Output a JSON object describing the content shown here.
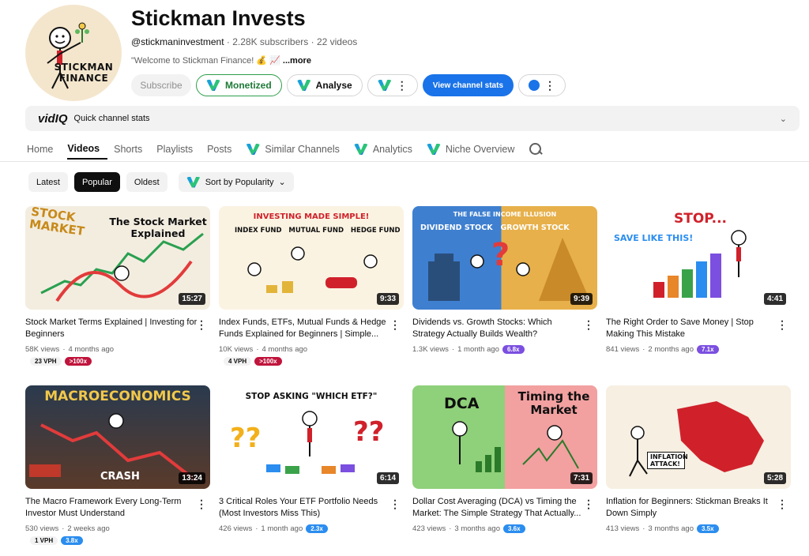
{
  "channel": {
    "avatar_text_1": "STICKMAN",
    "avatar_text_2": "FINANCE",
    "name": "Stickman Invests",
    "handle": "@stickmaninvestment",
    "stats": " · 2.28K subscribers · 22 videos",
    "description": "\"Welcome to Stickman Finance! 💰 📈",
    "more": "...more"
  },
  "buttons": {
    "subscribe": "Subscribe",
    "monetized": "Monetized",
    "analyse": "Analyse",
    "view_stats": "View channel stats"
  },
  "vidiq": {
    "logo": "vidIQ",
    "label": "Quick channel stats"
  },
  "tabs": [
    {
      "label": "Home"
    },
    {
      "label": "Videos"
    },
    {
      "label": "Shorts"
    },
    {
      "label": "Playlists"
    },
    {
      "label": "Posts"
    },
    {
      "label": "Similar Channels"
    },
    {
      "label": "Analytics"
    },
    {
      "label": "Niche Overview"
    }
  ],
  "chips": {
    "latest": "Latest",
    "popular": "Popular",
    "oldest": "Oldest",
    "sort": "Sort by Popularity"
  },
  "videos": [
    {
      "title": "Stock Market Terms Explained | Investing for Beginners",
      "duration": "15:27",
      "views": "58K views",
      "age": "4 months ago",
      "vph": "23 VPH",
      "badge": ">100x",
      "thumb_a": "STOCK MARKET",
      "thumb_b": "The Stock Market Explained"
    },
    {
      "title": "Index Funds, ETFs, Mutual Funds & Hedge Funds Explained for Beginners | Simple...",
      "duration": "9:33",
      "views": "10K views",
      "age": "4 months ago",
      "vph": "4 VPH",
      "badge": ">100x",
      "thumb_a": "INVESTING MADE SIMPLE!",
      "thumb_b": "INDEX FUND   MUTUAL FUND   HEDGE FUND   ETF"
    },
    {
      "title": "Dividends vs. Growth Stocks: Which Strategy Actually Builds Wealth?",
      "duration": "9:39",
      "views": "1.3K views",
      "age": "1 month ago",
      "badge": "6.8x",
      "thumb_a": "THE FALSE INCOME ILLUSION",
      "thumb_b": "DIVIDEND STOCK   GROWTH STOCK"
    },
    {
      "title": "The Right Order to Save Money | Stop Making This Mistake",
      "duration": "4:41",
      "views": "841 views",
      "age": "2 months ago",
      "badge": "7.1x",
      "thumb_a": "STOP...",
      "thumb_b": "SAVE LIKE THIS!"
    },
    {
      "title": "The Macro Framework Every Long-Term Investor Must Understand",
      "duration": "13:24",
      "views": "530 views",
      "age": "2 weeks ago",
      "vph": "1 VPH",
      "badge": "3.8x",
      "thumb_a": "MACROECONOMICS",
      "thumb_b": "CRASH"
    },
    {
      "title": "3 Critical Roles Your ETF Portfolio Needs (Most Investors Miss This)",
      "duration": "6:14",
      "views": "426 views",
      "age": "1 month ago",
      "badge": "2.3x",
      "thumb_a": "STOP ASKING \"WHICH ETF?\"",
      "thumb_b": "???"
    },
    {
      "title": "Dollar Cost Averaging (DCA) vs Timing the Market: The Simple Strategy That Actually...",
      "duration": "7:31",
      "views": "423 views",
      "age": "3 months ago",
      "badge": "3.6x",
      "thumb_a": "DCA",
      "thumb_b": "Timing the Market"
    },
    {
      "title": "Inflation for Beginners: Stickman Breaks It Down Simply",
      "duration": "5:28",
      "views": "413 views",
      "age": "3 months ago",
      "badge": "3.5x",
      "thumb_a": "INFLATION ATTACK!",
      "thumb_b": ""
    }
  ]
}
